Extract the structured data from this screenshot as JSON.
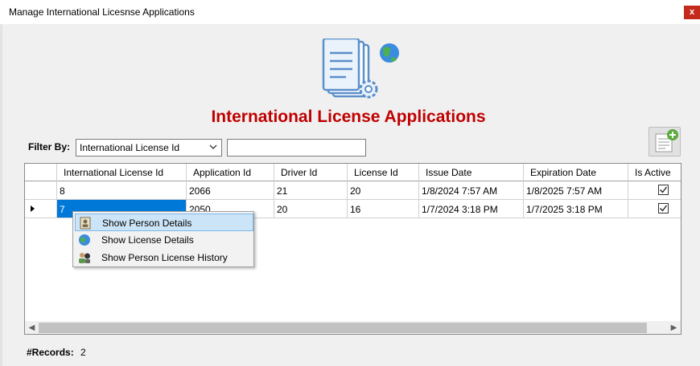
{
  "window": {
    "title": "Manage International Licesnse Applications",
    "close_glyph": "x"
  },
  "header": {
    "title": "International License Applications",
    "title_color": "#c00000",
    "hero_icon": "documents-gear-globe-icon"
  },
  "filter": {
    "label": "Filter By:",
    "selected": "International License Id",
    "text_value": ""
  },
  "toolbar": {
    "add_icon": "add-application-icon"
  },
  "table": {
    "columns": [
      "International License Id",
      "Application Id",
      "Driver Id",
      "License Id",
      "Issue Date",
      "Expiration Date",
      "Is Active"
    ],
    "rows": [
      {
        "international_license_id": "8",
        "application_id": "2066",
        "driver_id": "21",
        "license_id": "20",
        "issue_date": "1/8/2024 7:57 AM",
        "expiration_date": "1/8/2025 7:57 AM",
        "is_active": true
      },
      {
        "international_license_id": "7",
        "application_id": "2050",
        "driver_id": "20",
        "license_id": "16",
        "issue_date": "1/7/2024 3:18 PM",
        "expiration_date": "1/7/2025 3:18 PM",
        "is_active": true
      }
    ],
    "selected_row": 1,
    "selection_color": "#0078d7"
  },
  "context_menu": {
    "items": [
      {
        "label": "Show Person Details",
        "icon": "person-card-icon",
        "highlighted": true
      },
      {
        "label": "Show License Details",
        "icon": "globe-icon",
        "highlighted": false
      },
      {
        "label": "Show Person License History",
        "icon": "people-history-icon",
        "highlighted": false
      }
    ]
  },
  "footer": {
    "records_label": "#Records:",
    "records_value": "2"
  }
}
